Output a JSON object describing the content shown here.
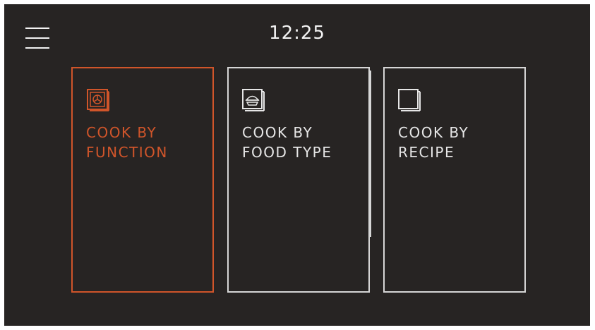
{
  "header": {
    "clock": "12:25",
    "menu_icon": "hamburger-menu-icon"
  },
  "cards": [
    {
      "label": "COOK BY\nFUNCTION",
      "icon": "oven-function-icon",
      "selected": true
    },
    {
      "label": "COOK BY\nFOOD TYPE",
      "icon": "food-dish-icon",
      "selected": false
    },
    {
      "label": "COOK BY\nRECIPE",
      "icon": "recipe-book-icon",
      "selected": false
    }
  ],
  "colors": {
    "background": "#272423",
    "accent": "#d0552a",
    "text": "#e6e6e6",
    "border": "#d6d6d6"
  }
}
